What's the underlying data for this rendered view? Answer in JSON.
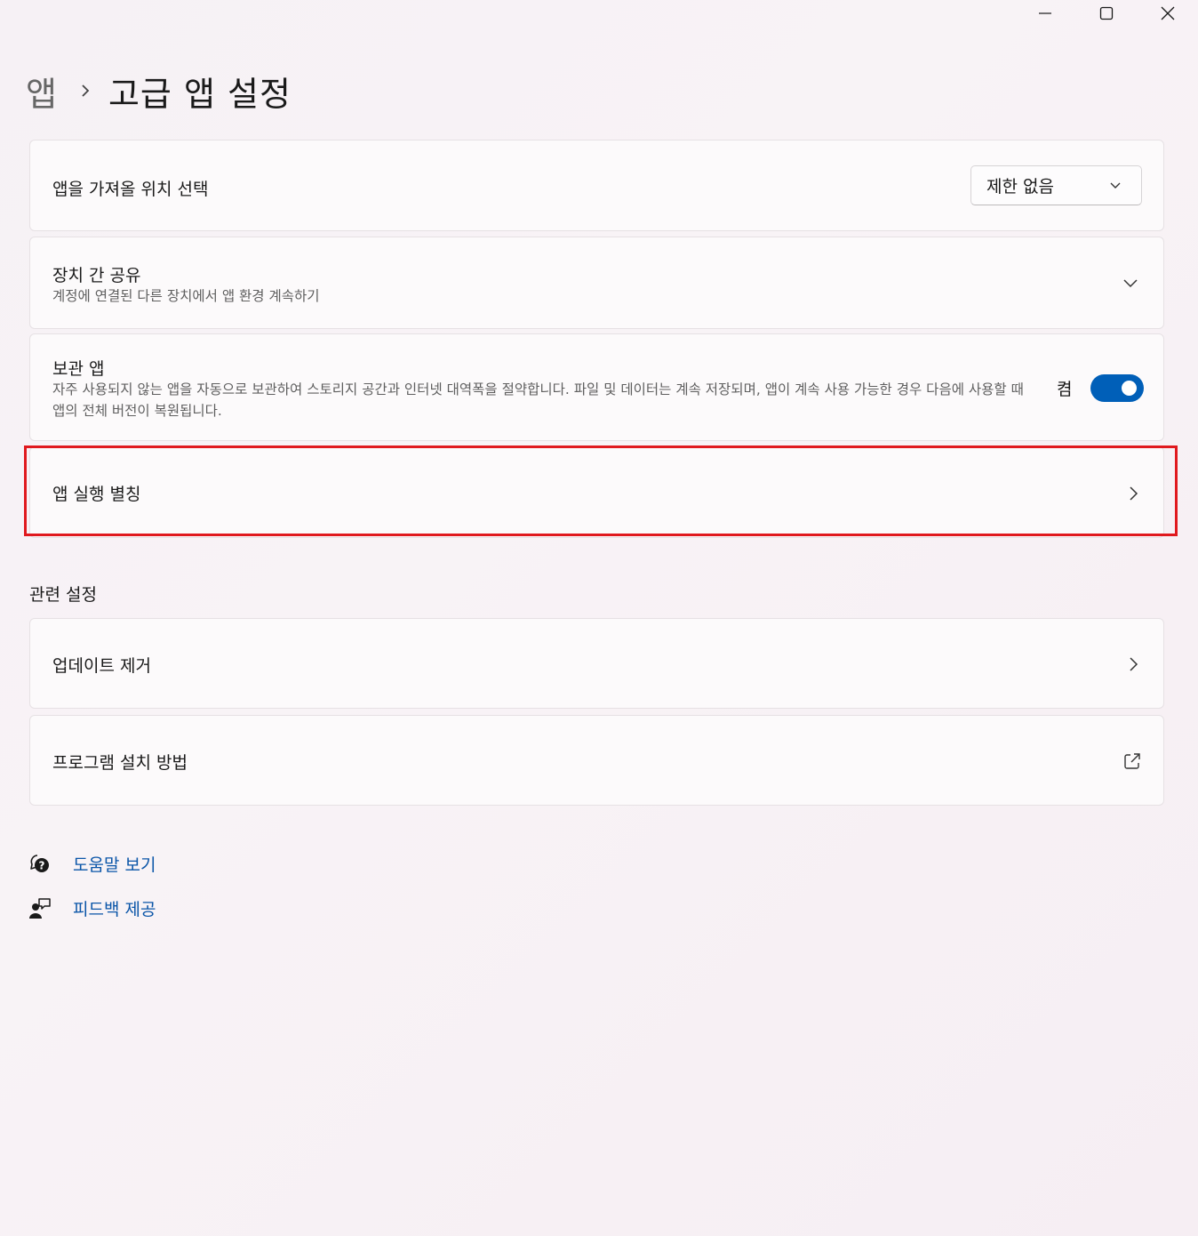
{
  "window": {
    "minimize_icon": "minimize-icon",
    "maximize_icon": "maximize-icon",
    "close_icon": "close-icon"
  },
  "breadcrumb": {
    "parent": "앱",
    "separator_icon": "chevron-right-icon",
    "current": "고급 앱 설정"
  },
  "settings": {
    "install_source": {
      "label": "앱을 가져올 위치 선택",
      "selected": "제한 없음"
    },
    "share_across_devices": {
      "title": "장치 간 공유",
      "description": "계정에 연결된 다른 장치에서 앱 환경 계속하기"
    },
    "archive_apps": {
      "title": "보관 앱",
      "description": "자주 사용되지 않는 앱을 자동으로 보관하여 스토리지 공간과 인터넷 대역폭을 절약합니다. 파일 및 데이터는 계속 저장되며, 앱이 계속 사용 가능한 경우 다음에 사용할 때 앱의 전체 버전이 복원됩니다.",
      "toggle_label": "켬",
      "toggle_on": true
    },
    "app_execution_aliases": {
      "label": "앱 실행 별칭"
    }
  },
  "related": {
    "title": "관련 설정",
    "items": [
      {
        "label": "업데이트 제거",
        "icon": "chevron-right-icon"
      },
      {
        "label": "프로그램 설치 방법",
        "icon": "external-link-icon"
      }
    ]
  },
  "footer": {
    "help": "도움말 보기",
    "feedback": "피드백 제공"
  },
  "colors": {
    "accent": "#005fb8",
    "link": "#0a55a8",
    "highlight": "#e0191e"
  }
}
